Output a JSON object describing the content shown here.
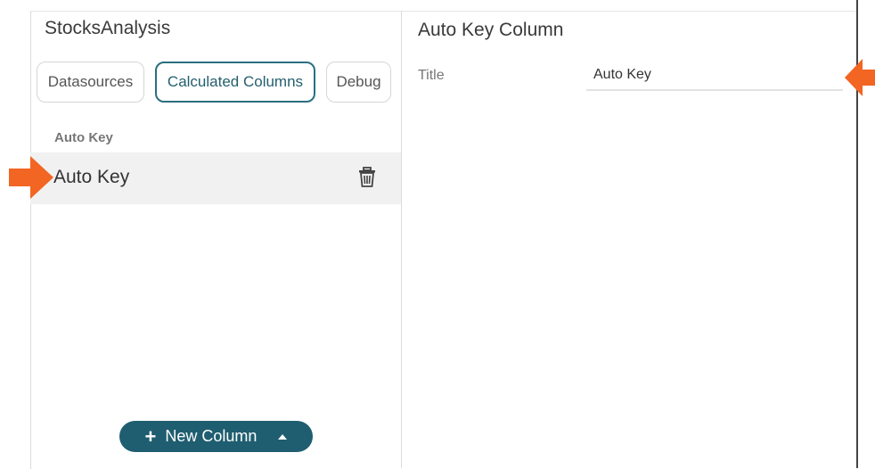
{
  "app": {
    "title": "StocksAnalysis"
  },
  "tabs": [
    {
      "label": "Datasources",
      "active": false
    },
    {
      "label": "Calculated Columns",
      "active": true
    },
    {
      "label": "Debug",
      "active": false
    }
  ],
  "list": {
    "section_label": "Auto Key",
    "items": [
      {
        "label": "Auto Key",
        "selected": true,
        "action_icon": "trash-icon"
      }
    ]
  },
  "new_column_button": {
    "label": "New Column",
    "icon": "plus-icon",
    "menu_icon": "caret-up-icon"
  },
  "editor": {
    "title": "Auto Key Column",
    "fields": [
      {
        "label": "Title",
        "value": "Auto Key"
      }
    ]
  },
  "annotations": {
    "arrow_color": "#f26522"
  },
  "colors": {
    "accent": "#1f5e70",
    "active_tab_border": "#2a6f80"
  }
}
